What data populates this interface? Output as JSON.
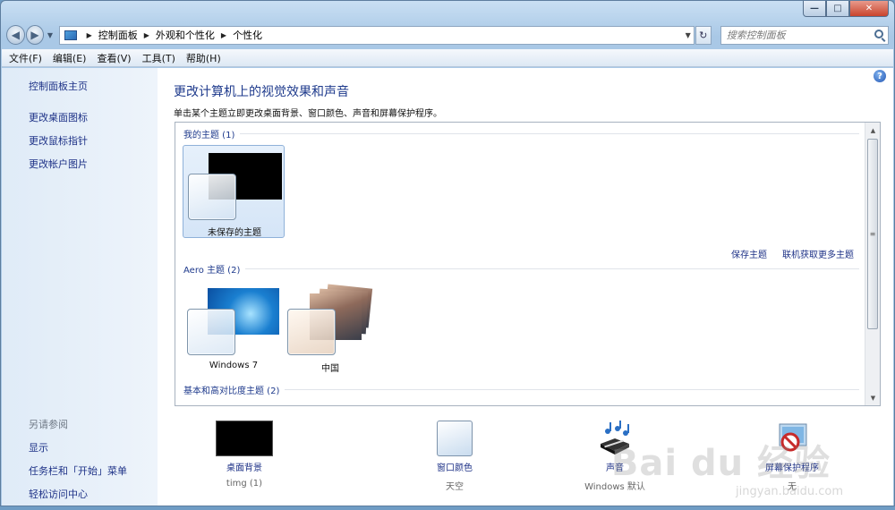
{
  "window": {
    "caption_buttons": {
      "minimize": "—",
      "maximize": "□",
      "close": "✕"
    }
  },
  "nav": {
    "back": "◀",
    "forward": "▶",
    "recent_dropdown": "▼",
    "breadcrumbs": [
      "控制面板",
      "外观和个性化",
      "个性化"
    ],
    "crumb_separator": "▶",
    "address_dropdown": "▼",
    "refresh": "↻",
    "search_placeholder": "搜索控制面板"
  },
  "menubar": {
    "items": [
      "文件(F)",
      "编辑(E)",
      "查看(V)",
      "工具(T)",
      "帮助(H)"
    ]
  },
  "sidebar": {
    "links": [
      "控制面板主页",
      "更改桌面图标",
      "更改鼠标指针",
      "更改帐户图片"
    ],
    "see_also_title": "另请参阅",
    "see_also_links": [
      "显示",
      "任务栏和「开始」菜单",
      "轻松访问中心"
    ]
  },
  "main": {
    "help": "?",
    "title": "更改计算机上的视觉效果和声音",
    "description": "单击某个主题立即更改桌面背景、窗口颜色、声音和屏幕保护程序。",
    "groups": {
      "my_themes": "我的主题 (1)",
      "aero_themes": "Aero 主题 (2)",
      "basic_themes": "基本和高对比度主题 (2)"
    },
    "my_theme_name": "未保存的主题",
    "aero_theme_names": [
      "Windows 7",
      "中国"
    ],
    "save_theme": "保存主题",
    "get_more_themes": "联机获取更多主题",
    "scroll_up": "▲",
    "scroll_down": "▼",
    "scroll_grip": "≡"
  },
  "settings": [
    {
      "icon": "desktop-background-icon",
      "label": "桌面背景",
      "value": "timg (1)"
    },
    {
      "icon": "window-color-icon",
      "label": "窗口颜色",
      "value": "天空"
    },
    {
      "icon": "sound-icon",
      "label": "声音",
      "value": "Windows 默认"
    },
    {
      "icon": "screensaver-icon",
      "label": "屏幕保护程序",
      "value": "无"
    }
  ],
  "watermark": {
    "main": "Bai du 经验",
    "sub": "jingyan.baidu.com"
  }
}
